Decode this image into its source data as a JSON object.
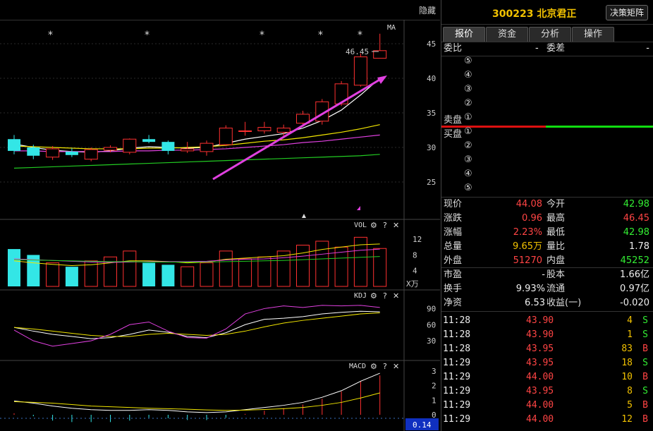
{
  "chart": {
    "hide_label": "隐藏",
    "ma_label": "MA",
    "high_marker": "46.45",
    "price_ticks": [
      "45",
      "40",
      "35",
      "30",
      "25"
    ],
    "vol_label": "VOL",
    "vol_ticks": [
      "12",
      "8",
      "4"
    ],
    "vol_unit": "X万",
    "kdj_label": "KDJ",
    "kdj_ticks": [
      "90",
      "60",
      "30"
    ],
    "macd_label": "MACD",
    "macd_ticks": [
      "3",
      "2",
      "1",
      "0"
    ],
    "macd_value": "0.14",
    "gear_icon": "gear-icon",
    "help_icon": "question-icon",
    "close_icon": "close-icon"
  },
  "chart_data": {
    "type": "candlestick",
    "candles": [
      {
        "o": 31.2,
        "c": 29.5,
        "h": 31.8,
        "l": 29.0,
        "up": false
      },
      {
        "o": 30.0,
        "c": 28.8,
        "h": 30.4,
        "l": 28.3,
        "up": false
      },
      {
        "o": 28.6,
        "c": 29.8,
        "h": 30.2,
        "l": 28.2,
        "up": true
      },
      {
        "o": 29.4,
        "c": 28.9,
        "h": 29.9,
        "l": 28.6,
        "up": false
      },
      {
        "o": 28.3,
        "c": 29.7,
        "h": 30.0,
        "l": 28.0,
        "up": true
      },
      {
        "o": 29.6,
        "c": 30.0,
        "h": 30.3,
        "l": 29.3,
        "up": true
      },
      {
        "o": 29.3,
        "c": 31.2,
        "h": 31.3,
        "l": 29.0,
        "up": true
      },
      {
        "o": 31.2,
        "c": 30.8,
        "h": 31.8,
        "l": 30.6,
        "up": false
      },
      {
        "o": 30.8,
        "c": 29.5,
        "h": 31.0,
        "l": 29.0,
        "up": false
      },
      {
        "o": 29.5,
        "c": 29.8,
        "h": 30.8,
        "l": 29.2,
        "up": true
      },
      {
        "o": 29.4,
        "c": 30.6,
        "h": 31.0,
        "l": 28.8,
        "up": true
      },
      {
        "o": 30.4,
        "c": 32.8,
        "h": 33.2,
        "l": 30.2,
        "up": true
      },
      {
        "o": 32.3,
        "c": 32.4,
        "h": 33.7,
        "l": 31.7,
        "up": true
      },
      {
        "o": 32.4,
        "c": 32.9,
        "h": 33.7,
        "l": 32.0,
        "up": true
      },
      {
        "o": 32.2,
        "c": 32.8,
        "h": 33.3,
        "l": 31.6,
        "up": true
      },
      {
        "o": 33.5,
        "c": 34.8,
        "h": 35.3,
        "l": 33.3,
        "up": true
      },
      {
        "o": 33.8,
        "c": 36.6,
        "h": 37.0,
        "l": 33.3,
        "up": true
      },
      {
        "o": 36.3,
        "c": 39.2,
        "h": 39.6,
        "l": 36.0,
        "up": true
      },
      {
        "o": 39.0,
        "c": 43.1,
        "h": 43.6,
        "l": 38.8,
        "up": true
      },
      {
        "o": 42.9,
        "c": 44.0,
        "h": 46.45,
        "l": 42.9,
        "up": true
      }
    ],
    "volumes": [
      9.5,
      8.0,
      6.0,
      5.0,
      6.5,
      7.5,
      9.0,
      6.0,
      5.5,
      5.0,
      6.0,
      9.0,
      7.0,
      7.5,
      9.0,
      10.5,
      11.5,
      10.0,
      12.5,
      9.65
    ],
    "ma_lines": {
      "ma5": [
        30.5,
        30.0,
        29.6,
        29.4,
        29.3,
        29.5,
        29.9,
        30.1,
        30.0,
        29.9,
        30.0,
        30.6,
        31.2,
        31.6,
        32.0,
        32.8,
        33.9,
        35.4,
        37.6,
        40.0
      ],
      "ma10": [
        30.2,
        30.1,
        30.0,
        29.9,
        29.8,
        29.8,
        29.8,
        29.9,
        29.9,
        30.0,
        30.1,
        30.3,
        30.6,
        30.9,
        31.1,
        31.4,
        31.8,
        32.2,
        32.7,
        33.3
      ],
      "ma20": [
        29.5,
        29.5,
        29.4,
        29.4,
        29.4,
        29.4,
        29.5,
        29.5,
        29.6,
        29.6,
        29.7,
        29.8,
        30.0,
        30.2,
        30.4,
        30.7,
        30.9,
        31.2,
        31.5,
        31.8
      ],
      "ma60": [
        27.0,
        27.1,
        27.2,
        27.3,
        27.4,
        27.5,
        27.6,
        27.7,
        27.8,
        27.9,
        28.0,
        28.1,
        28.2,
        28.3,
        28.4,
        28.5,
        28.6,
        28.7,
        28.8,
        29.0
      ]
    },
    "vol_ma": {
      "a": [
        6.5,
        6.0,
        5.6,
        5.3,
        5.5,
        6.0,
        6.5,
        6.5,
        6.3,
        6.0,
        6.2,
        6.9,
        7.2,
        7.5,
        7.8,
        8.5,
        9.4,
        10.0,
        10.6,
        10.8
      ],
      "b": [
        7.0,
        6.8,
        6.6,
        6.4,
        6.2,
        6.1,
        6.2,
        6.3,
        6.3,
        6.3,
        6.4,
        6.7,
        6.9,
        7.0,
        7.3,
        7.7,
        8.2,
        8.7,
        9.2,
        9.5
      ],
      "c": [
        6.8,
        6.7,
        6.6,
        6.5,
        6.4,
        6.3,
        6.3,
        6.2,
        6.2,
        6.2,
        6.2,
        6.3,
        6.4,
        6.5,
        6.6,
        6.8,
        7.0,
        7.2,
        7.4,
        7.6
      ]
    },
    "kdj": {
      "k": [
        55,
        48,
        42,
        38,
        34,
        36,
        42,
        50,
        46,
        38,
        36,
        45,
        60,
        70,
        72,
        75,
        80,
        83,
        85,
        84
      ],
      "d": [
        55,
        52,
        48,
        44,
        40,
        38,
        38,
        42,
        44,
        42,
        40,
        42,
        48,
        56,
        63,
        68,
        72,
        76,
        80,
        82
      ],
      "j": [
        50,
        30,
        20,
        25,
        30,
        42,
        60,
        65,
        48,
        36,
        35,
        52,
        80,
        90,
        95,
        92,
        96,
        95,
        96,
        92
      ]
    },
    "macd": {
      "dif": [
        0.95,
        0.8,
        0.6,
        0.45,
        0.35,
        0.3,
        0.3,
        0.35,
        0.3,
        0.2,
        0.15,
        0.2,
        0.35,
        0.5,
        0.65,
        0.85,
        1.2,
        1.65,
        2.3,
        2.85
      ],
      "dea": [
        0.9,
        0.85,
        0.8,
        0.7,
        0.6,
        0.55,
        0.5,
        0.45,
        0.42,
        0.38,
        0.33,
        0.3,
        0.32,
        0.36,
        0.42,
        0.5,
        0.65,
        0.85,
        1.15,
        1.5
      ],
      "hist": [
        0.1,
        -0.1,
        -0.4,
        -0.5,
        -0.5,
        -0.5,
        -0.4,
        -0.2,
        -0.24,
        -0.36,
        -0.36,
        -0.2,
        0.06,
        0.28,
        0.46,
        0.7,
        1.1,
        1.6,
        2.3,
        2.7
      ]
    },
    "ylim": [
      25,
      47
    ]
  },
  "panel": {
    "code_name": "300223 北京君正",
    "decision_btn": "决策矩阵",
    "tabs": [
      "报价",
      "资金",
      "分析",
      "操作"
    ],
    "order_ratio_label": "委比",
    "order_ratio_value": "-",
    "order_diff_label": "委差",
    "order_diff_value": "-",
    "sell_label": "卖盘",
    "buy_label": "买盘",
    "sell_levels": [
      "⑤",
      "④",
      "③",
      "②",
      "①"
    ],
    "buy_levels": [
      "①",
      "②",
      "③",
      "④",
      "⑤"
    ],
    "quote": [
      {
        "l1": "现价",
        "v1": "44.08",
        "c1": "red",
        "l2": "今开",
        "v2": "42.98",
        "c2": "green"
      },
      {
        "l1": "涨跌",
        "v1": "0.96",
        "c1": "red",
        "l2": "最高",
        "v2": "46.45",
        "c2": "red"
      },
      {
        "l1": "涨幅",
        "v1": "2.23%",
        "c1": "red",
        "l2": "最低",
        "v2": "42.98",
        "c2": "green"
      },
      {
        "l1": "总量",
        "v1": "9.65万",
        "c1": "yellow",
        "l2": "量比",
        "v2": "1.78",
        "c2": "white"
      },
      {
        "l1": "外盘",
        "v1": "51270",
        "c1": "red",
        "l2": "内盘",
        "v2": "45252",
        "c2": "green"
      }
    ],
    "fundamentals": [
      {
        "l1": "市盈",
        "v1": "-",
        "l2": "股本",
        "v2": "1.66亿"
      },
      {
        "l1": "换手",
        "v1": "9.93%",
        "l2": "流通",
        "v2": "0.97亿"
      },
      {
        "l1": "净资",
        "v1": "6.53",
        "l2": "收益(一)",
        "v2": "-0.020"
      }
    ],
    "ticks": [
      {
        "t": "11:28",
        "p": "43.90",
        "v": "4",
        "s": "S"
      },
      {
        "t": "11:28",
        "p": "43.90",
        "v": "1",
        "s": "S"
      },
      {
        "t": "11:28",
        "p": "43.95",
        "v": "83",
        "s": "B"
      },
      {
        "t": "11:29",
        "p": "43.95",
        "v": "18",
        "s": "S"
      },
      {
        "t": "11:29",
        "p": "44.00",
        "v": "10",
        "s": "B"
      },
      {
        "t": "11:29",
        "p": "43.95",
        "v": "8",
        "s": "S"
      },
      {
        "t": "11:29",
        "p": "44.00",
        "v": "5",
        "s": "B"
      },
      {
        "t": "11:29",
        "p": "44.00",
        "v": "12",
        "s": "B"
      }
    ]
  }
}
